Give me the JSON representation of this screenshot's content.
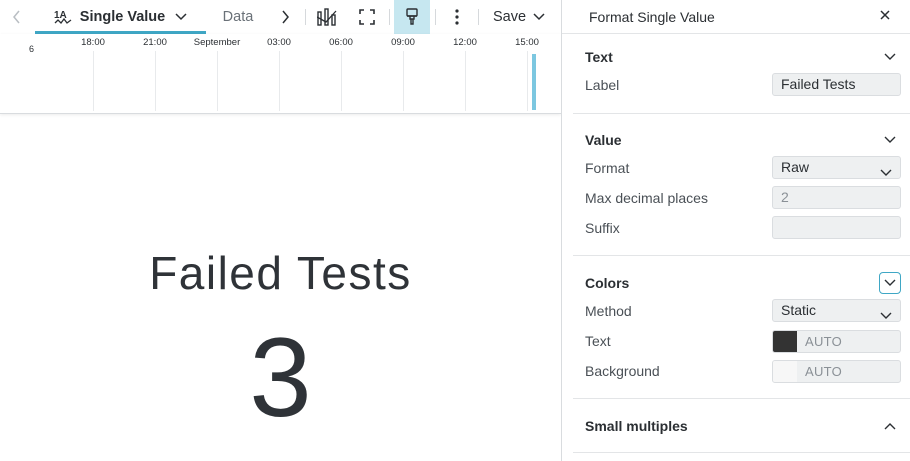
{
  "toolbar": {
    "back_icon": "chevron-left-icon",
    "viz_icon": "single-value-icon",
    "viz_label": "Single Value",
    "data_label": "Data",
    "forward_icon": "chevron-right-icon",
    "chart_icon": "chart-type-icon",
    "fullscreen_icon": "fullscreen-icon",
    "paint_icon": "paintbrush-icon",
    "more_icon": "more-vertical-icon",
    "save_label": "Save",
    "accent": "#3fa7c5"
  },
  "timeline": {
    "y_tick": "6",
    "ticks": [
      "18:00",
      "21:00",
      "September",
      "03:00",
      "06:00",
      "09:00",
      "12:00",
      "15:00"
    ],
    "bar_color": "#7cc7e0"
  },
  "single_value": {
    "label": "Failed Tests",
    "value": "3"
  },
  "panel": {
    "title": "Format Single Value",
    "close_icon": "close-icon",
    "text_section": {
      "heading": "Text",
      "label_label": "Label",
      "label_value": "Failed Tests"
    },
    "value_section": {
      "heading": "Value",
      "format_label": "Format",
      "format_value": "Raw",
      "max_decimal_label": "Max decimal places",
      "max_decimal_placeholder": "2",
      "suffix_label": "Suffix",
      "suffix_value": ""
    },
    "colors_section": {
      "heading": "Colors",
      "method_label": "Method",
      "method_value": "Static",
      "text_label": "Text",
      "text_color_value": "AUTO",
      "text_swatch": "#333333",
      "background_label": "Background",
      "background_color_value": "AUTO",
      "background_swatch": "#f7f7f7"
    },
    "small_multiples_section": {
      "heading": "Small multiples"
    }
  }
}
